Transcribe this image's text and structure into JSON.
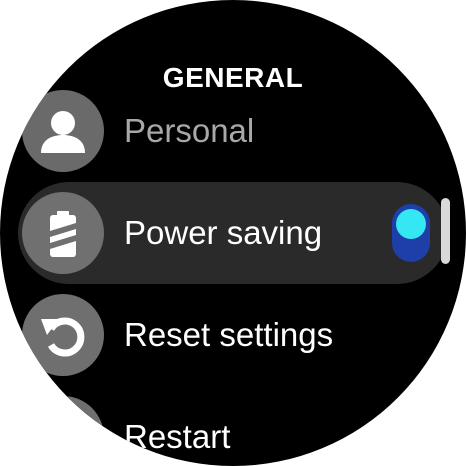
{
  "header": {
    "title": "GENERAL"
  },
  "menu": {
    "items": [
      {
        "label": "Personal",
        "icon": "person-icon"
      },
      {
        "label": "Power saving",
        "icon": "battery-saver-icon",
        "toggle": {
          "on": true
        }
      },
      {
        "label": "Reset settings",
        "icon": "reset-icon"
      },
      {
        "label": "Restart",
        "icon": "restart-icon"
      }
    ]
  },
  "colors": {
    "background": "#000000",
    "selected_row": "#2a2a2a",
    "toggle_track": "#1d3fa7",
    "toggle_knob": "#35e7f2"
  }
}
